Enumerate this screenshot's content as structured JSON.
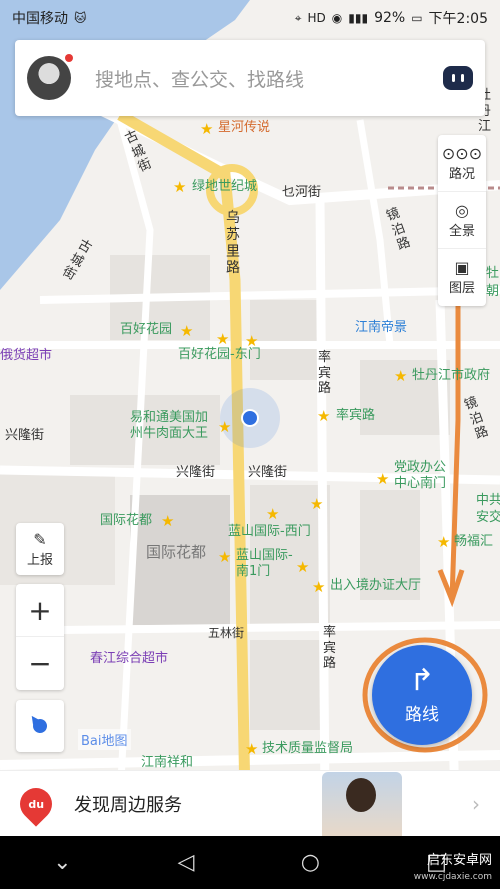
{
  "status_bar": {
    "carrier": "中国移动",
    "battery": "92%",
    "time": "下午2:05",
    "icons": [
      "location-icon",
      "hd-icon",
      "eye-icon",
      "signal-icon",
      "battery-icon"
    ]
  },
  "search": {
    "placeholder": "搜地点、查公交、找路线",
    "voice_icon": "robot-assistant-icon"
  },
  "right_controls": [
    {
      "label": "路况",
      "icon": "traffic-icon"
    },
    {
      "label": "全景",
      "icon": "panorama-icon"
    },
    {
      "label": "图层",
      "icon": "layers-icon"
    }
  ],
  "left_controls": {
    "report": "上报",
    "zoom_in": "+",
    "zoom_out": "−"
  },
  "route_button": {
    "label": "路线",
    "icon": "turn-right-arrow-icon"
  },
  "map_labels": {
    "pois": [
      "星河传说",
      "绿地世纪城",
      "百好花园",
      "百好花园-东门",
      "易和通美国加州牛肉面大王",
      "江南帝景",
      "牡丹江市政府",
      "率宾路",
      "党政办公中心南门",
      "国际花都",
      "蓝山国际-西门",
      "蓝山国际-南1门",
      "出入境办证大厅",
      "技术质量监督局",
      "江南祥和",
      "畅福汇",
      "中共",
      "安交",
      "牡",
      "朝"
    ],
    "streets": [
      "乌苏里路",
      "乜河街",
      "兴隆街",
      "兴隆街",
      "兴隆街",
      "率宾路",
      "率宾路",
      "五林街",
      "镜泊路",
      "镜泊路",
      "古城街",
      "古城街",
      "牡丹江"
    ],
    "shops": [
      "春江综合超市",
      "俄货超市"
    ],
    "blocks": [
      "国际花都",
      "蓝山国际"
    ],
    "baidu": "Bai地图"
  },
  "banner": {
    "text": "发现周边服务",
    "logo": "du"
  },
  "navbar": {
    "back_icon": "back-triangle-icon",
    "home_icon": "home-circle-icon",
    "recent_icon": "recent-square-icon",
    "menu_icon": "chevron-down-icon"
  },
  "watermark": {
    "title": "启东安卓网",
    "url": "www.cjdaxie.com"
  },
  "colors": {
    "accent": "#2f6fe0",
    "river": "#a9c6e8",
    "main_road": "#f7d774",
    "annotation": "#ea8a3e"
  }
}
